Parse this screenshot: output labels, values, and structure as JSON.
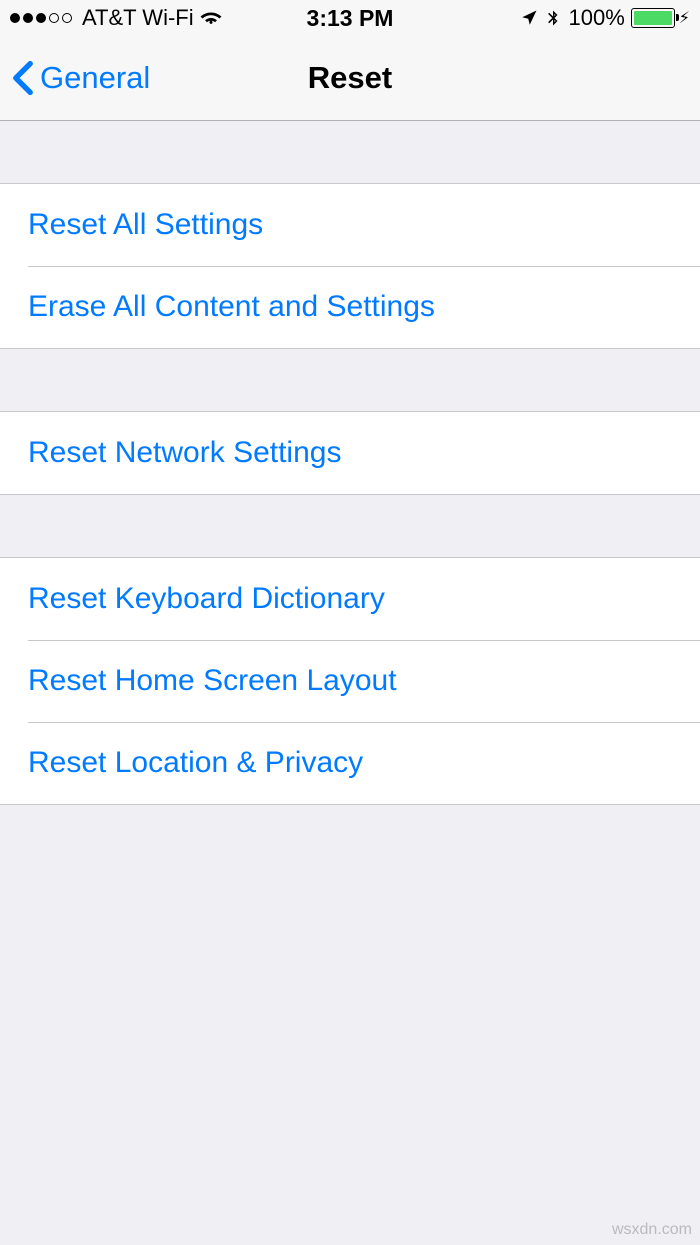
{
  "status_bar": {
    "carrier": "AT&T Wi-Fi",
    "time": "3:13 PM",
    "battery_percent": "100%"
  },
  "nav": {
    "back_label": "General",
    "title": "Reset"
  },
  "sections": [
    {
      "items": [
        {
          "key": "reset-all-settings",
          "label": "Reset All Settings"
        },
        {
          "key": "erase-all-content",
          "label": "Erase All Content and Settings"
        }
      ]
    },
    {
      "items": [
        {
          "key": "reset-network-settings",
          "label": "Reset Network Settings"
        }
      ]
    },
    {
      "items": [
        {
          "key": "reset-keyboard-dictionary",
          "label": "Reset Keyboard Dictionary"
        },
        {
          "key": "reset-home-screen-layout",
          "label": "Reset Home Screen Layout"
        },
        {
          "key": "reset-location-privacy",
          "label": "Reset Location & Privacy"
        }
      ]
    }
  ],
  "watermark": "wsxdn.com",
  "colors": {
    "link": "#007aff",
    "background": "#efeff4",
    "separator": "#c8c7cc",
    "battery_fill": "#4cd964"
  }
}
